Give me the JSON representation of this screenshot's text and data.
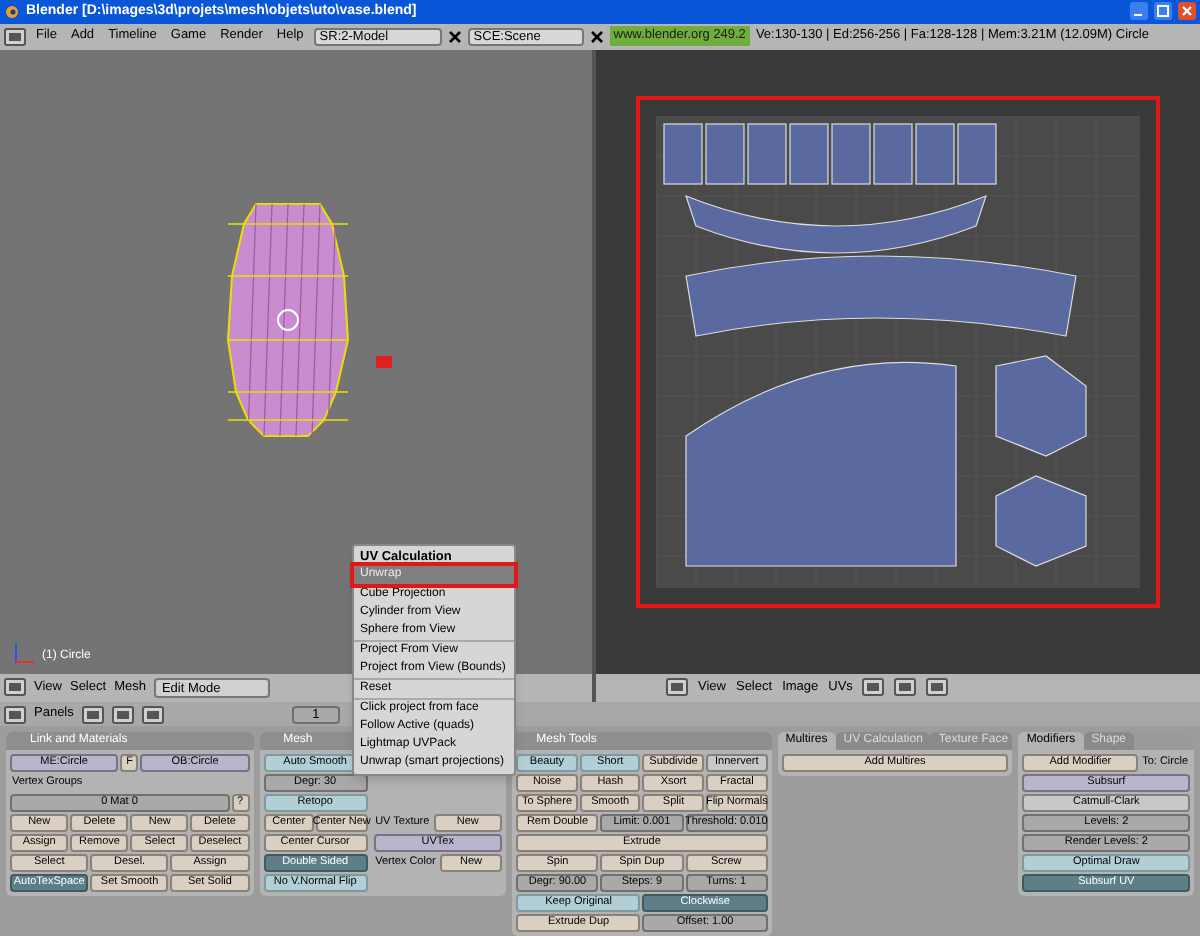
{
  "window": {
    "title": "Blender [D:\\images\\3d\\projets\\mesh\\objets\\uto\\vase.blend]"
  },
  "menu_bar": {
    "items": [
      "File",
      "Add",
      "Timeline",
      "Game",
      "Render",
      "Help"
    ],
    "screen": "SR:2-Model",
    "scene": "SCE:Scene",
    "version": "www.blender.org 249.2",
    "stats": "Ve:130-130 | Ed:256-256 | Fa:128-128 | Mem:3.21M (12.09M) Circle"
  },
  "viewport": {
    "object_label": "(1) Circle"
  },
  "view3d_header": {
    "menus": [
      "View",
      "Select",
      "Mesh"
    ],
    "mode": "Edit Mode"
  },
  "uv_header": {
    "menus": [
      "View",
      "Select",
      "Image",
      "UVs"
    ]
  },
  "buttons_header": {
    "label": "Panels",
    "frame": "1"
  },
  "panels": [
    {
      "title": "Link and Materials",
      "columns": [
        [
          [
            {
              "label": "ME:Circle",
              "kind": "field"
            },
            {
              "label": "F",
              "kind": "small"
            },
            {
              "label": "OB:Circle",
              "kind": "field"
            }
          ],
          [
            {
              "label": "Vertex Groups",
              "kind": "label"
            }
          ],
          [
            {
              "label": "0 Mat 0",
              "kind": "num"
            },
            {
              "label": "?",
              "kind": "small"
            }
          ],
          [
            {
              "label": "New",
              "kind": "button"
            },
            {
              "label": "Delete",
              "kind": "button"
            },
            {
              "label": "New",
              "kind": "button"
            },
            {
              "label": "Delete",
              "kind": "button"
            }
          ],
          [
            {
              "label": "Assign",
              "kind": "button"
            },
            {
              "label": "Remove",
              "kind": "button"
            },
            {
              "label": "Select",
              "kind": "button"
            },
            {
              "label": "Deselect",
              "kind": "button"
            }
          ],
          [
            {
              "label": "Select",
              "kind": "button"
            },
            {
              "label": "Desel.",
              "kind": "button"
            },
            {
              "label": "Assign",
              "kind": "button"
            }
          ],
          [
            {
              "label": "AutoTexSpace",
              "kind": "toggle",
              "on": true
            },
            {
              "label": "Set Smooth",
              "kind": "button"
            },
            {
              "label": "Set Solid",
              "kind": "button"
            }
          ]
        ]
      ]
    },
    {
      "title": "Mesh",
      "columns": [
        [
          [
            {
              "label": "Auto Smooth",
              "kind": "toggle",
              "on": false
            }
          ],
          [
            {
              "label": "Degr: 30",
              "kind": "num"
            }
          ],
          [
            {
              "label": "Retopo",
              "kind": "toggle",
              "on": false
            }
          ],
          [
            {
              "label": "Center",
              "kind": "button"
            },
            {
              "label": "Center New",
              "kind": "button"
            }
          ],
          [
            {
              "label": "Center Cursor",
              "kind": "button"
            }
          ],
          [
            {
              "label": "Double Sided",
              "kind": "toggle",
              "on": true
            }
          ],
          [
            {
              "label": "No V.Normal Flip",
              "kind": "toggle",
              "on": false
            }
          ]
        ],
        [
          [
            {
              "label": "UV Texture",
              "kind": "label"
            },
            {
              "label": "New",
              "kind": "button"
            }
          ],
          [
            {
              "label": "UVTex",
              "kind": "field"
            }
          ],
          [
            {
              "label": "Vertex Color",
              "kind": "label"
            },
            {
              "label": "New",
              "kind": "button"
            }
          ]
        ]
      ]
    },
    {
      "title": "Mesh Tools",
      "columns": [
        [
          [
            {
              "label": "Beauty",
              "kind": "toggle",
              "on": false
            },
            {
              "label": "Short",
              "kind": "toggle",
              "on": false
            },
            {
              "label": "Subdivide",
              "kind": "button"
            },
            {
              "label": "Innervert",
              "kind": "menu"
            }
          ],
          [
            {
              "label": "Noise",
              "kind": "button"
            },
            {
              "label": "Hash",
              "kind": "button"
            },
            {
              "label": "Xsort",
              "kind": "button"
            },
            {
              "label": "Fractal",
              "kind": "button"
            }
          ],
          [
            {
              "label": "To Sphere",
              "kind": "button"
            },
            {
              "label": "Smooth",
              "kind": "button"
            },
            {
              "label": "Split",
              "kind": "button"
            },
            {
              "label": "Flip Normals",
              "kind": "button"
            }
          ],
          [
            {
              "label": "Rem Double",
              "kind": "button"
            },
            {
              "label": "Limit: 0.001",
              "kind": "num"
            },
            {
              "label": "Threshold: 0.010",
              "kind": "num"
            }
          ],
          [
            {
              "label": "Extrude",
              "kind": "button"
            }
          ],
          [
            {
              "label": "Spin",
              "kind": "button"
            },
            {
              "label": "Spin Dup",
              "kind": "button"
            },
            {
              "label": "Screw",
              "kind": "button"
            }
          ],
          [
            {
              "label": "Degr: 90.00",
              "kind": "num"
            },
            {
              "label": "Steps: 9",
              "kind": "num"
            },
            {
              "label": "Turns: 1",
              "kind": "num"
            }
          ],
          [
            {
              "label": "Keep Original",
              "kind": "toggle",
              "on": false
            },
            {
              "label": "Clockwise",
              "kind": "toggle",
              "on": true
            }
          ],
          [
            {
              "label": "Extrude Dup",
              "kind": "button"
            },
            {
              "label": "Offset: 1.00",
              "kind": "num"
            }
          ]
        ]
      ]
    },
    {
      "tabs": [
        {
          "label": "Multires",
          "selected": true
        },
        {
          "label": "UV Calculation",
          "selected": false
        },
        {
          "label": "Texture Face",
          "selected": false
        }
      ],
      "columns": [
        [
          [
            {
              "label": "Add Multires",
              "kind": "button"
            }
          ]
        ]
      ]
    },
    {
      "tabs": [
        {
          "label": "Modifiers",
          "selected": true
        },
        {
          "label": "Shape",
          "selected": false
        }
      ],
      "columns": [
        [
          [
            {
              "label": "Add Modifier",
              "kind": "button"
            },
            {
              "label": "To: Circle",
              "kind": "label"
            }
          ],
          [
            {
              "label": "Subsurf",
              "kind": "field"
            }
          ],
          [
            {
              "label": "Catmull-Clark",
              "kind": "menu"
            }
          ],
          [
            {
              "label": "Levels: 2",
              "kind": "num"
            }
          ],
          [
            {
              "label": "Render Levels: 2",
              "kind": "num"
            }
          ],
          [
            {
              "label": "Optimal Draw",
              "kind": "toggle",
              "on": false
            }
          ],
          [
            {
              "label": "Subsurf UV",
              "kind": "toggle",
              "on": true
            }
          ]
        ]
      ]
    }
  ],
  "uv_menu": {
    "title": "UV Calculation",
    "groups": [
      [
        {
          "label": "Unwrap",
          "selected": true
        }
      ],
      [
        {
          "label": "Cube Projection",
          "selected": false
        },
        {
          "label": "Cylinder from View",
          "selected": false
        },
        {
          "label": "Sphere from View",
          "selected": false
        }
      ],
      [
        {
          "label": "Project From View",
          "selected": false
        },
        {
          "label": "Project from View (Bounds)",
          "selected": false
        }
      ],
      [
        {
          "label": "Reset",
          "selected": false
        }
      ],
      [
        {
          "label": "Click project from face",
          "selected": false
        },
        {
          "label": "Follow Active (quads)",
          "selected": false
        },
        {
          "label": "Lightmap UVPack",
          "selected": false
        },
        {
          "label": "Unwrap (smart projections)",
          "selected": false
        }
      ]
    ]
  }
}
